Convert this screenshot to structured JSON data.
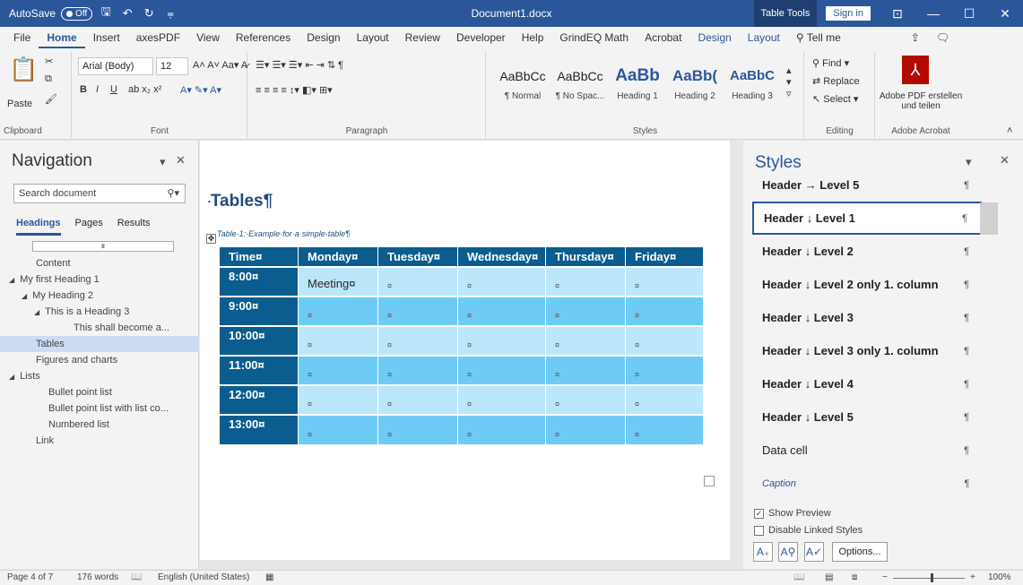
{
  "titlebar": {
    "autosave_label": "AutoSave",
    "autosave_state": "Off",
    "doc_title": "Document1.docx",
    "table_tools": "Table Tools",
    "sign_in": "Sign in",
    "min_glyph": "—",
    "max_glyph": "☐",
    "close_glyph": "✕"
  },
  "tabs": [
    "File",
    "Home",
    "Insert",
    "axesPDF",
    "View",
    "References",
    "Design",
    "Layout",
    "Review",
    "Developer",
    "Help",
    "GrindEQ Math",
    "Acrobat"
  ],
  "context_tabs": [
    "Design",
    "Layout"
  ],
  "tell_me": "Tell me",
  "ribbon": {
    "paste": "Paste",
    "clipboard": "Clipboard",
    "font_name": "Arial (Body)",
    "font_size": "12",
    "font_group": "Font",
    "paragraph_group": "Paragraph",
    "styles_group": "Styles",
    "styles": [
      {
        "preview": "AaBbCc",
        "name": "¶ Normal"
      },
      {
        "preview": "AaBbCc",
        "name": "¶ No Spac..."
      },
      {
        "preview": "AaBb",
        "name": "Heading 1"
      },
      {
        "preview": "AaBb(",
        "name": "Heading 2"
      },
      {
        "preview": "AaBbC",
        "name": "Heading 3"
      }
    ],
    "find": "Find",
    "replace": "Replace",
    "select": "Select",
    "editing_group": "Editing",
    "adobe_label": "Adobe PDF erstellen und teilen",
    "adobe_group": "Adobe Acrobat"
  },
  "nav": {
    "title": "Navigation",
    "search_placeholder": "Search document",
    "tabs": [
      "Headings",
      "Pages",
      "Results"
    ],
    "items": [
      {
        "label": "Content",
        "indent": 1,
        "arrow": ""
      },
      {
        "label": "My first Heading 1",
        "indent": 1,
        "arrow": "◢"
      },
      {
        "label": "My Heading 2",
        "indent": 2,
        "arrow": "◢"
      },
      {
        "label": "This is a Heading 3",
        "indent": 3,
        "arrow": "◢"
      },
      {
        "label": "This shall become a...",
        "indent": 4,
        "arrow": ""
      },
      {
        "label": "Tables",
        "indent": 1,
        "arrow": "",
        "selected": true
      },
      {
        "label": "Figures and charts",
        "indent": 1,
        "arrow": ""
      },
      {
        "label": "Lists",
        "indent": 1,
        "arrow": "◢"
      },
      {
        "label": "Bullet point list",
        "indent": 2,
        "arrow": ""
      },
      {
        "label": "Bullet point list with list co...",
        "indent": 2,
        "arrow": ""
      },
      {
        "label": "Numbered list",
        "indent": 2,
        "arrow": ""
      },
      {
        "label": "Link",
        "indent": 1,
        "arrow": ""
      }
    ]
  },
  "document": {
    "heading": "Tables¶",
    "caption": "Table·1:·Example·for·a·simple·table¶",
    "table": {
      "headers": [
        "Time¤",
        "Monday¤",
        "Tuesday¤",
        "Wednesday¤",
        "Thursday¤",
        "Friday¤"
      ],
      "rows": [
        [
          "8:00¤",
          "Meeting¤",
          "¤",
          "¤",
          "¤",
          "¤"
        ],
        [
          "9:00¤",
          "¤",
          "¤",
          "¤",
          "¤",
          "¤"
        ],
        [
          "10:00¤",
          "¤",
          "¤",
          "¤",
          "¤",
          "¤"
        ],
        [
          "11:00¤",
          "¤",
          "¤",
          "¤",
          "¤",
          "¤"
        ],
        [
          "12:00¤",
          "¤",
          "¤",
          "¤",
          "¤",
          "¤"
        ],
        [
          "13:00¤",
          "¤",
          "¤",
          "¤",
          "¤",
          "¤"
        ]
      ]
    }
  },
  "styles_pane": {
    "title": "Styles",
    "items": [
      {
        "label": "Header → Level 5",
        "kind": "bold"
      },
      {
        "label": "Header ↓ Level 1",
        "kind": "bold",
        "selected": true
      },
      {
        "label": "Header ↓ Level 2",
        "kind": "bold"
      },
      {
        "label": "Header ↓ Level 2 only 1. column",
        "kind": "bold"
      },
      {
        "label": "Header ↓ Level 3",
        "kind": "bold"
      },
      {
        "label": "Header ↓ Level 3 only 1. column",
        "kind": "bold"
      },
      {
        "label": "Header ↓ Level 4",
        "kind": "bold"
      },
      {
        "label": "Header ↓ Level 5",
        "kind": "bold"
      },
      {
        "label": "Data cell",
        "kind": "norm"
      },
      {
        "label": "Caption",
        "kind": "cap"
      }
    ],
    "show_preview": "Show Preview",
    "disable_linked": "Disable Linked Styles",
    "options": "Options..."
  },
  "status": {
    "page": "Page 4 of 7",
    "words": "176 words",
    "language": "English (United States)",
    "zoom": "100%"
  },
  "colors": {
    "accent": "#2b579a",
    "table_header": "#0a5d8e",
    "row_a": "#6ecbf6",
    "row_b": "#bce7fb"
  }
}
